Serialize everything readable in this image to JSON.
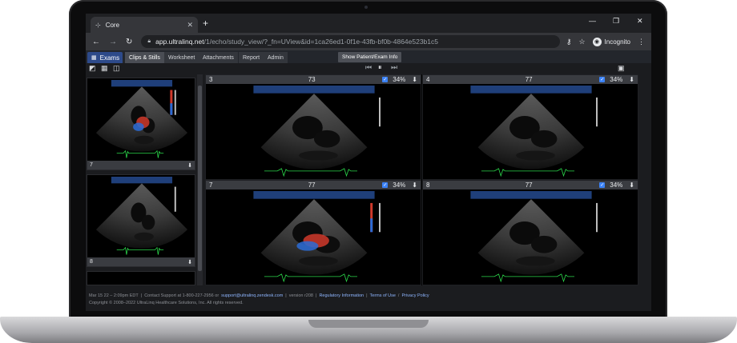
{
  "browser": {
    "tab_title": "Core",
    "tab_close": "✕",
    "new_tab": "+",
    "url_host": "app.ultralinq.net",
    "url_path": "/1/echo/study_view/?_fn=UView&id=1ca26ed1-0f1e-43fb-bf0b-4864e523b1c5",
    "incognito_label": "Incognito"
  },
  "appnav": {
    "exams": "Exams",
    "tabs": [
      "Clips & Stills",
      "Worksheet",
      "Attachments",
      "Report",
      "Admin"
    ],
    "show_info": "Show Patient/Exam Info"
  },
  "thumbnails": [
    {
      "label": "7"
    },
    {
      "label": "8"
    }
  ],
  "panes": [
    {
      "number": "3",
      "frame": "73",
      "zoom": "34%",
      "doppler": false
    },
    {
      "number": "4",
      "frame": "77",
      "zoom": "34%",
      "doppler": false
    },
    {
      "number": "7",
      "frame": "77",
      "zoom": "34%",
      "doppler": true
    },
    {
      "number": "8",
      "frame": "77",
      "zoom": "34%",
      "doppler": false
    }
  ],
  "footer": {
    "date": "Mar 15 22 – 2:09pm EDT",
    "support_text": "Contact Support at 1-800-227-2956 or",
    "support_email": "support@ultralinq.zendesk.com",
    "version": "version r208",
    "regulatory": "Regulatory Information",
    "terms": "Terms of Use",
    "privacy": "Privacy Policy",
    "copyright": "Copyright © 2008–2022 UltraLinq Healthcare Solutions, Inc. All rights reserved."
  },
  "colors": {
    "exams_tab": "#2d4a8a",
    "check": "#3b82f6",
    "link": "#8fb6ff",
    "ecg": "#2bd64a"
  }
}
